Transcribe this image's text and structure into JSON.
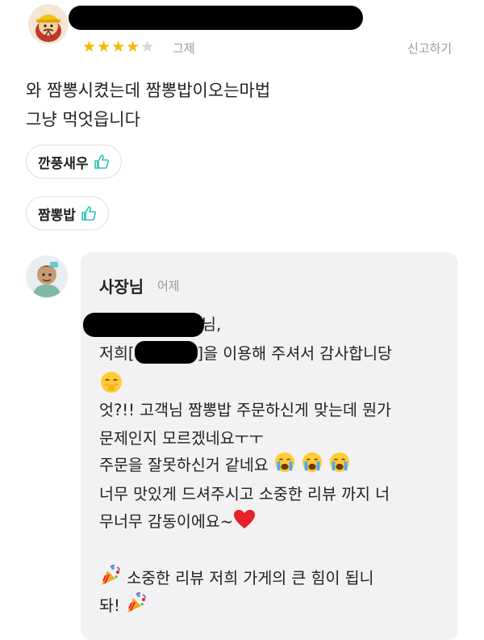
{
  "review": {
    "rating": 4,
    "rating_max": 5,
    "date": "그제",
    "report_label": "신고하기",
    "text_lines": [
      "와 짬뽕시켰는데 짬뽕밥이오는마법",
      "그냥 먹엇읍니다"
    ],
    "menu_chips": [
      "깐풍새우",
      "짬뽕밥"
    ]
  },
  "reply": {
    "author": "사장님",
    "date": "어제",
    "line1_suffix": "님,",
    "line2_prefix": "저희[",
    "line2_suffix": "]을 이용해 주셔서 감사합니당",
    "line4": "엇?!! 고객님 짬뽕밥 주문하신게 맞는데 뭔가",
    "line5": "문제인지 모르겠네요ㅜㅜ",
    "line6": "주문을 잘못하신거 같네요",
    "line7": "너무 맛있게 드셔주시고 소중한 리뷰 까지 너",
    "line8": "무너무 감동이에요~",
    "line9": "소중한 리뷰 저희 가게의 큰 힘이 됩니",
    "line10": "돠!"
  },
  "colors": {
    "star_on": "#f5b800",
    "star_off": "#d6d6d6",
    "thumb_icon": "#2ac1bc",
    "reply_bg": "#f2f2f4",
    "heart": "#e8202a"
  },
  "icons": [
    "reviewer-avatar-icon",
    "owner-avatar-icon",
    "thumbs-up-icon",
    "hush-emoji-icon",
    "crying-emoji-icon",
    "heart-icon",
    "party-popper-icon"
  ]
}
